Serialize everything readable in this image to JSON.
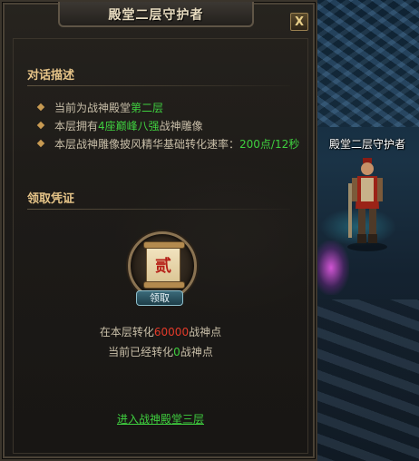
{
  "window": {
    "title": "殿堂二层守护者",
    "close_label": "X"
  },
  "dialog": {
    "section_title": "对话描述",
    "lines": [
      {
        "pre": "当前为战神殿堂",
        "hl": "第二层",
        "post": ""
      },
      {
        "pre": "本层拥有",
        "hl": "4座巅峰八强",
        "post": "战神雕像"
      },
      {
        "pre": "本层战神雕像披风精华基础转化速率：",
        "hl": "200点/12秒",
        "post": ""
      }
    ]
  },
  "claim": {
    "section_title": "领取凭证",
    "emblem_char": "贰",
    "button_label": "领取",
    "converted_pre": "在本层转化",
    "converted_value": "60000",
    "converted_post": "战神点",
    "current_pre": "当前已经转化",
    "current_value": "0",
    "current_post": "战神点"
  },
  "next_floor_link": "进入战神殿堂三层",
  "npc": {
    "name": "殿堂二层守护者"
  },
  "colors": {
    "highlight_green": "#3fcf3f",
    "highlight_red": "#e33a2a",
    "section_gold": "#e6c488"
  },
  "icons": {
    "bullet": "diamond-bullet-icon",
    "emblem": "scroll-token-icon",
    "close": "close-icon"
  }
}
